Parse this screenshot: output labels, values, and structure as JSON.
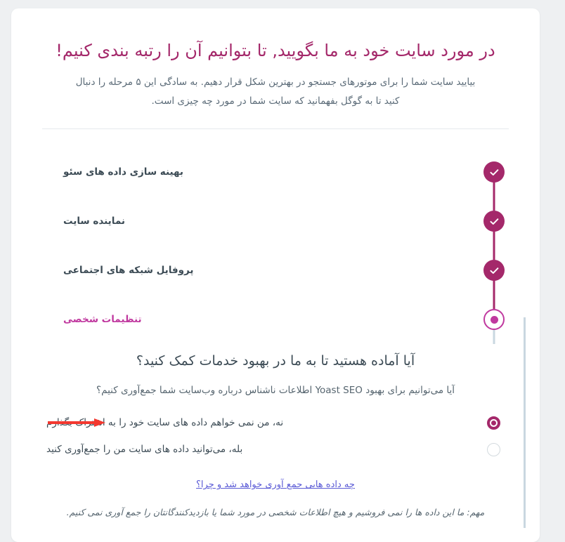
{
  "page": {
    "direction": "rtl",
    "background_color": "#eef0f2",
    "card_background": "#ffffff",
    "accent_color": "#a4286a",
    "active_accent_color": "#c0399f",
    "link_color": "#5b5bd6",
    "annotation_color": "#f3382f"
  },
  "header": {
    "title": "در مورد سایت خود به ما بگویید, تا بتوانیم آن را رتبه بندی کنیم!",
    "intro": "بیایید سایت شما را برای موتورهای جستجو در بهترین شکل قرار دهیم. به سادگی این ۵ مرحله را دنبال کنید تا به گوگل بفهمانید که سایت شما در مورد چه چیزی است."
  },
  "stepper": {
    "steps": [
      {
        "label": "بهینه سازی داده های سئو",
        "state": "completed",
        "icon": "check-icon"
      },
      {
        "label": "نماینده سایت",
        "state": "completed",
        "icon": "check-icon"
      },
      {
        "label": "پروفایل شبکه های اجتماعی",
        "state": "completed",
        "icon": "check-icon"
      },
      {
        "label": "تنظیمات شخصی",
        "state": "active",
        "icon": "dot-icon"
      }
    ]
  },
  "question": {
    "title": "آیا آماده هستید تا به ما در بهبود خدمات کمک کنید؟",
    "subtitle": "آیا می‌توانیم برای بهبود Yoast SEO اطلاعات ناشناس درباره وب‌سایت شما جمع‌آوری کنیم؟",
    "options": [
      {
        "label": "نه، من نمی خواهم داده های سایت خود را به اشتراک بگذارم",
        "selected": true
      },
      {
        "label": "بله، می‌توانید داده های سایت من را جمع‌آوری کنید",
        "selected": false
      }
    ],
    "more_info_link": "چه داده هایی جمع آوری خواهد شد و چرا؟",
    "footer_note": "مهم: ما این داده ها را نمی فروشیم و هیچ اطلاعات شخصی در مورد شما یا بازدیدکنندگانتان را جمع آوری نمی کنیم."
  }
}
